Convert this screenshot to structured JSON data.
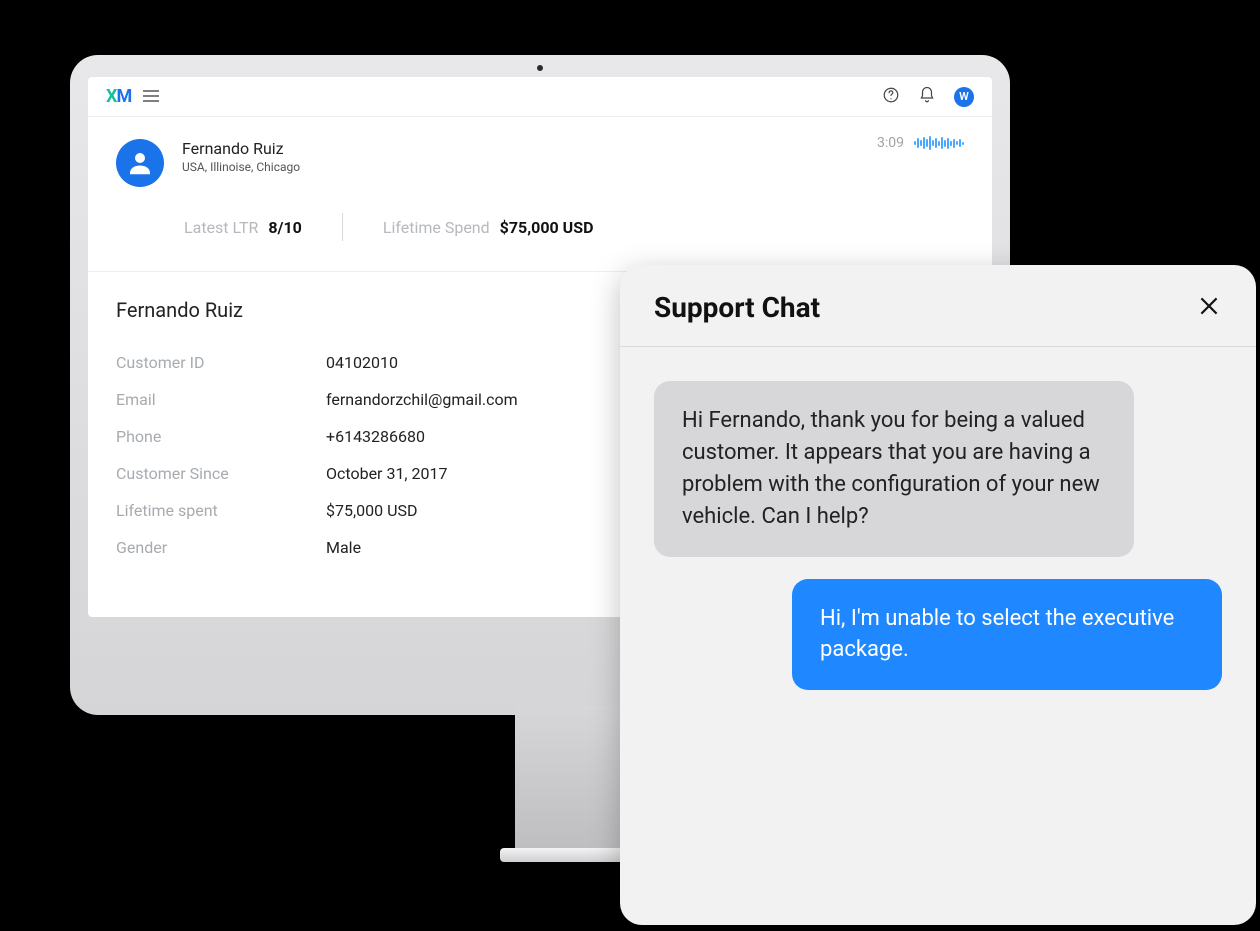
{
  "topbar": {
    "logo_x": "X",
    "logo_m": "M",
    "avatar_initial": "W"
  },
  "customer": {
    "name": "Fernando Ruiz",
    "location": "USA, Illinoise, Chicago",
    "call_time": "3:09"
  },
  "stats": {
    "ltr_label": "Latest LTR",
    "ltr_value": "8/10",
    "spend_label": "Lifetime Spend",
    "spend_value": "$75,000 USD"
  },
  "details": {
    "title": "Fernando Ruiz",
    "rows": [
      {
        "label": "Customer ID",
        "value": "04102010"
      },
      {
        "label": "Email",
        "value": "fernandorzchil@gmail.com"
      },
      {
        "label": "Phone",
        "value": "+6143286680"
      },
      {
        "label": "Customer Since",
        "value": "October 31, 2017"
      },
      {
        "label": "Lifetime spent",
        "value": "$75,000 USD"
      },
      {
        "label": "Gender",
        "value": "Male"
      }
    ]
  },
  "chat": {
    "title": "Support Chat",
    "messages": [
      {
        "role": "agent",
        "text": "Hi Fernando, thank you for being a valued customer. It appears that you are having a problem with the configuration of your new vehicle. Can I help?"
      },
      {
        "role": "user",
        "text": "Hi, I'm unable to select the executive package."
      }
    ]
  }
}
